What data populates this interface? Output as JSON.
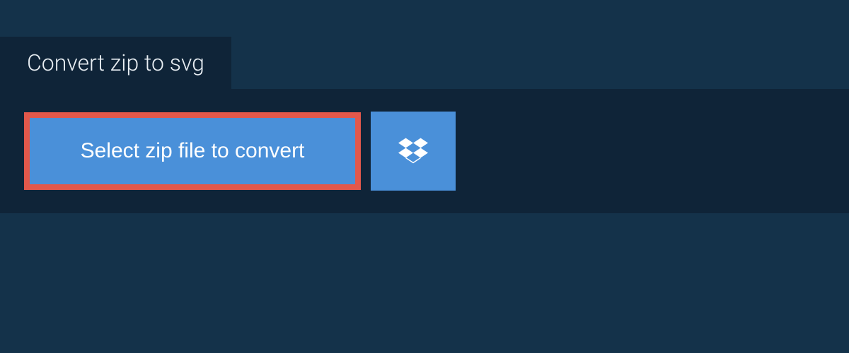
{
  "header": {
    "tab_label": "Convert zip to svg"
  },
  "actions": {
    "select_file_label": "Select zip file to convert",
    "dropbox_icon": "dropbox-icon"
  },
  "colors": {
    "background": "#14324a",
    "panel": "#0f2438",
    "button": "#4a90d9",
    "highlight_border": "#e2584b"
  }
}
